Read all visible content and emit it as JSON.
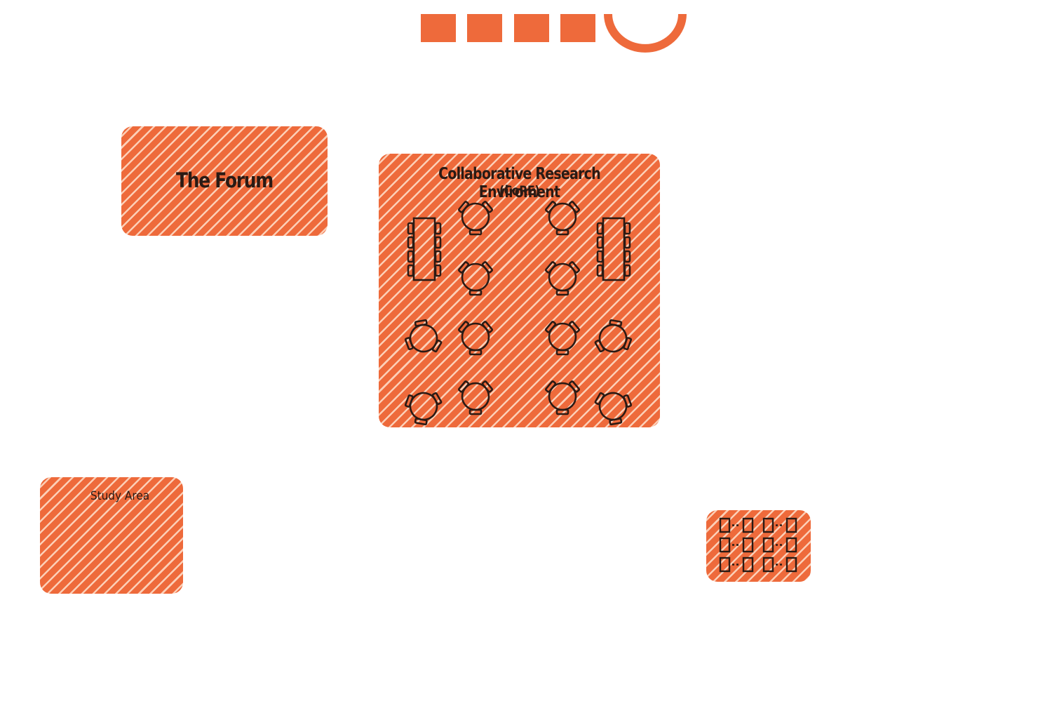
{
  "colors": {
    "room_fill": "#ee6a3b",
    "hatch": "#ffe1cd",
    "outline": "#2a1a14",
    "background": "#ffffff"
  },
  "rooms": {
    "forum": {
      "label": "The Forum"
    },
    "core": {
      "label_line1": "Collaborative Research Enviroment",
      "label_line2": "(CoRE)"
    },
    "study": {
      "label": "Study Area"
    },
    "pods": {
      "label": ""
    }
  },
  "furniture": {
    "core_long_tables": 2,
    "core_round_tables": 12,
    "pod_desk_pairs": 6
  }
}
